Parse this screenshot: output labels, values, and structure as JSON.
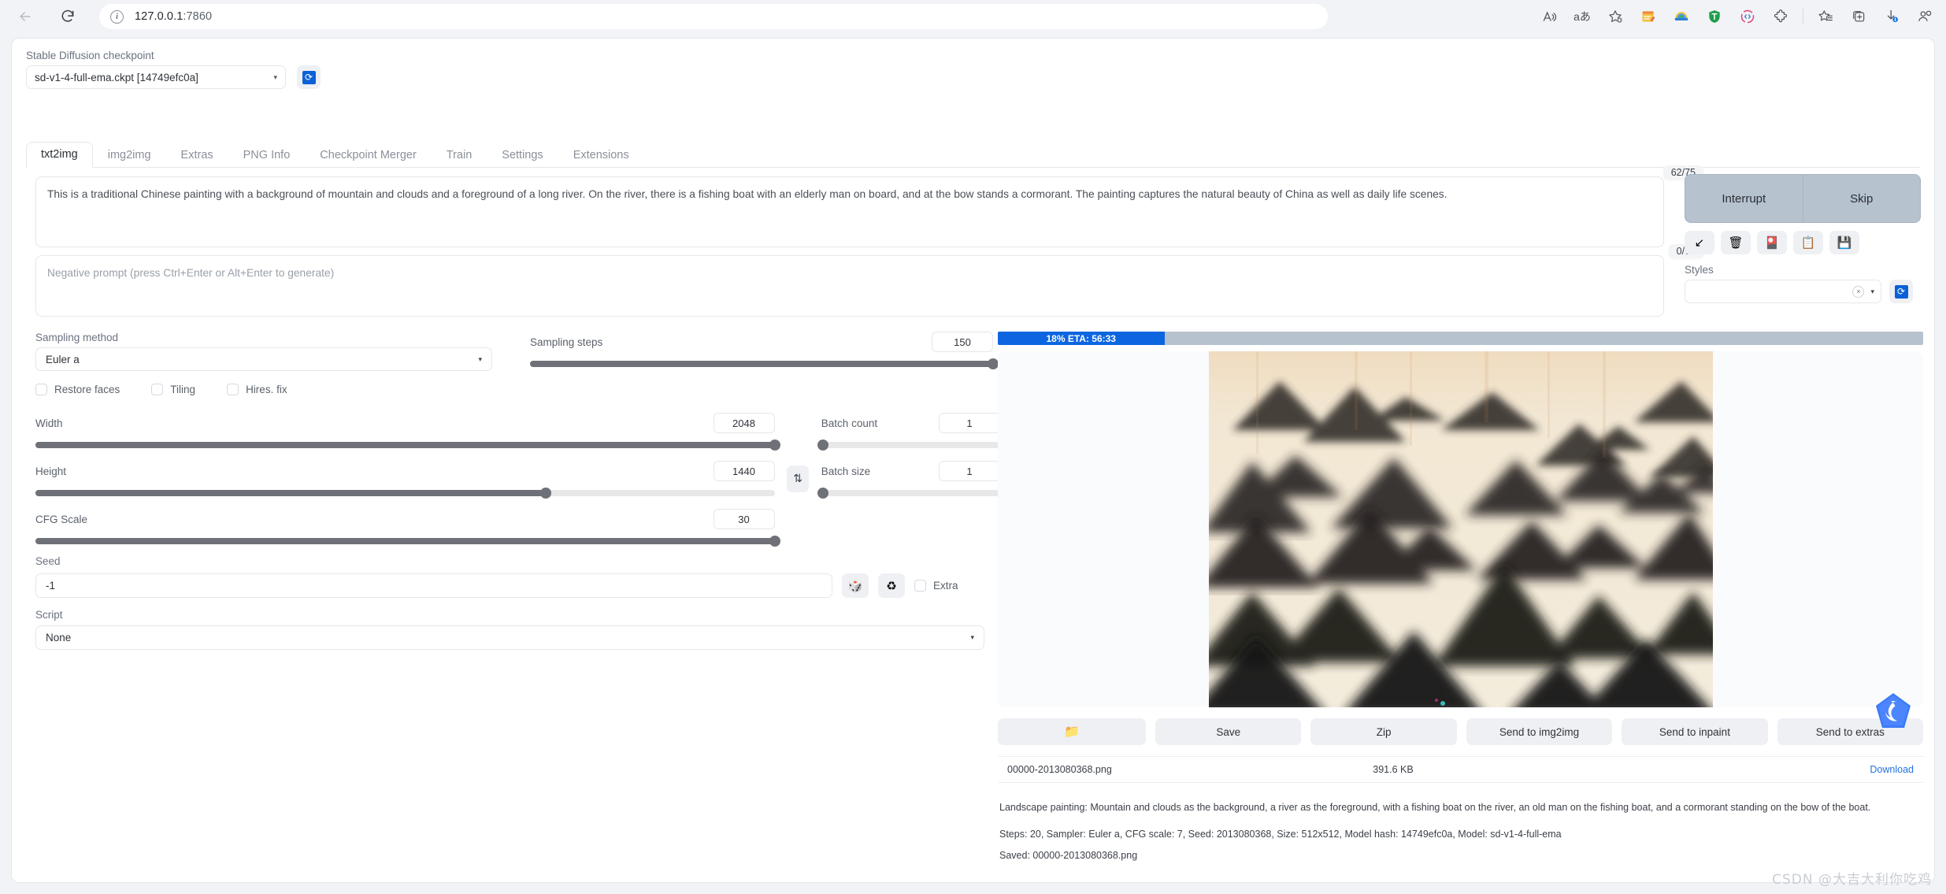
{
  "browser": {
    "back_icon": "back-arrow",
    "reload_icon": "reload",
    "info_icon": "info-circle",
    "url_host": "127.0.0.1",
    "url_port": ":7860",
    "toolbar_icons": [
      {
        "name": "read-aloud-icon",
        "glyph": "A"
      },
      {
        "name": "translate-icon",
        "glyph": "aあ"
      },
      {
        "name": "add-favorite-icon",
        "glyph": "☆"
      },
      {
        "name": "notes-extension-icon",
        "glyph": "📝"
      },
      {
        "name": "rainbow-extension-icon",
        "glyph": "🥣"
      },
      {
        "name": "shield-extension-icon",
        "glyph": "🛡"
      },
      {
        "name": "code-extension-icon",
        "glyph": "◎"
      },
      {
        "name": "puzzle-extensions-icon",
        "glyph": "🧩"
      },
      {
        "name": "favorites-list-icon",
        "glyph": "☆"
      },
      {
        "name": "collections-icon",
        "glyph": "⊞"
      },
      {
        "name": "downloads-icon",
        "glyph": "↓"
      },
      {
        "name": "profile-icon",
        "glyph": "👤"
      }
    ]
  },
  "checkpoint": {
    "label": "Stable Diffusion checkpoint",
    "value": "sd-v1-4-full-ema.ckpt [14749efc0a]",
    "caret": "▾",
    "refresh_icon": "refresh-icon",
    "refresh_glyph": "⟳"
  },
  "tabs": [
    {
      "label": "txt2img",
      "active": true
    },
    {
      "label": "img2img",
      "active": false
    },
    {
      "label": "Extras",
      "active": false
    },
    {
      "label": "PNG Info",
      "active": false
    },
    {
      "label": "Checkpoint Merger",
      "active": false
    },
    {
      "label": "Train",
      "active": false
    },
    {
      "label": "Settings",
      "active": false
    },
    {
      "label": "Extensions",
      "active": false
    }
  ],
  "prompt": {
    "positive_value": "This is a traditional Chinese painting with a background of mountain and clouds and a foreground of a long river. On the river, there is a fishing boat with an elderly man on board, and at the bow stands a cormorant. The painting captures the natural beauty of China as well as daily life scenes.",
    "positive_tokens": "62/75",
    "negative_placeholder": "Negative prompt (press Ctrl+Enter or Alt+Enter to generate)",
    "negative_tokens": "0/75"
  },
  "actions": {
    "interrupt": "Interrupt",
    "skip": "Skip",
    "small_buttons": [
      {
        "name": "arrow-down-left-icon",
        "glyph": "↙"
      },
      {
        "name": "trash-icon",
        "glyph": "🗑"
      },
      {
        "name": "paint-palette-icon",
        "glyph": "🎴"
      },
      {
        "name": "clipboard-icon",
        "glyph": "📋"
      },
      {
        "name": "floppy-save-icon",
        "glyph": "💾"
      }
    ],
    "styles_label": "Styles",
    "styles_value": "",
    "styles_clear": "×",
    "styles_caret": "▾",
    "styles_refresh_glyph": "⟳"
  },
  "params": {
    "sampling_method_label": "Sampling method",
    "sampling_method_value": "Euler a",
    "sampling_steps_label": "Sampling steps",
    "sampling_steps_value": "150",
    "sampling_steps_pct": 100,
    "restore_faces": "Restore faces",
    "tiling": "Tiling",
    "hires_fix": "Hires. fix",
    "width_label": "Width",
    "width_value": "2048",
    "width_pct": 100,
    "height_label": "Height",
    "height_value": "1440",
    "height_pct": 69,
    "cfg_label": "CFG Scale",
    "cfg_value": "30",
    "cfg_pct": 100,
    "batch_count_label": "Batch count",
    "batch_count_value": "1",
    "batch_count_pct": 0,
    "batch_size_label": "Batch size",
    "batch_size_value": "1",
    "batch_size_pct": 0,
    "swap_glyph": "⇅",
    "seed_label": "Seed",
    "seed_value": "-1",
    "dice_icon": "dice-icon",
    "dice_glyph": "🎲",
    "recycle_icon": "recycle-icon",
    "recycle_glyph": "♻",
    "extra_label": "Extra",
    "script_label": "Script",
    "script_value": "None",
    "caret": "▾"
  },
  "result": {
    "progress_text": "18% ETA: 56:33",
    "progress_pct": 18,
    "progress_color": "#0d66e0",
    "buttons": [
      {
        "name": "open-folder-button",
        "label": "📁"
      },
      {
        "name": "save-button",
        "label": "Save"
      },
      {
        "name": "zip-button",
        "label": "Zip"
      },
      {
        "name": "send-to-img2img-button",
        "label": "Send to img2img"
      },
      {
        "name": "send-to-inpaint-button",
        "label": "Send to inpaint"
      },
      {
        "name": "send-to-extras-button",
        "label": "Send to extras"
      }
    ],
    "file_name": "00000-2013080368.png",
    "file_size": "391.6 KB",
    "download_label": "Download",
    "caption": "Landscape painting: Mountain and clouds as the background, a river as the foreground, with a fishing boat on the river, an old man on the fishing boat, and a cormorant standing on the bow of the boat.",
    "params_line": "Steps: 20, Sampler: Euler a, CFG scale: 7, Seed: 2013080368, Size: 512x512, Model hash: 14749efc0a, Model: sd-v1-4-full-ema",
    "saved_line": "Saved: 00000-2013080368.png"
  },
  "watermark": "CSDN @大吉大利你吃鸡"
}
